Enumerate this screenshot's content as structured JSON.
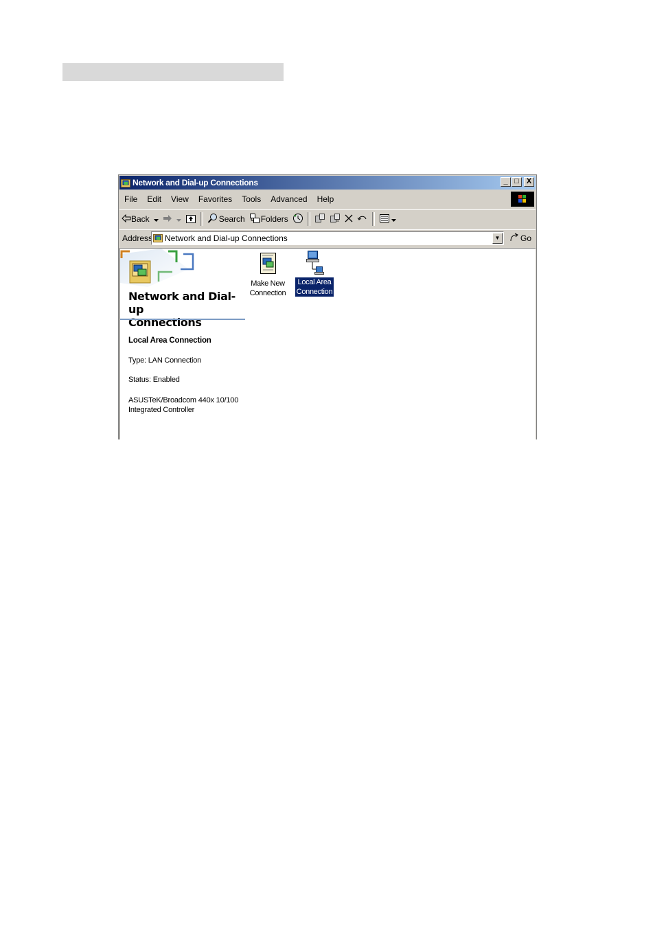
{
  "window": {
    "title": "Network and Dial-up Connections",
    "buttons": {
      "minimize": "_",
      "maximize": "□",
      "close": "X"
    }
  },
  "menu": [
    "File",
    "Edit",
    "View",
    "Favorites",
    "Tools",
    "Advanced",
    "Help"
  ],
  "toolbar": {
    "back": "Back",
    "search": "Search",
    "folders": "Folders"
  },
  "address": {
    "label": "Address",
    "value": "Network and Dial-up Connections",
    "go": "Go"
  },
  "panel": {
    "title_line1": "Network and Dial-up",
    "title_line2": "Connections",
    "selected_name": "Local Area Connection",
    "type": "Type: LAN Connection",
    "status": "Status: Enabled",
    "device_line1": "ASUSTeK/Broadcom 440x 10/100",
    "device_line2": "Integrated Controller"
  },
  "icons": [
    {
      "line1": "Make New",
      "line2": "Connection",
      "selected": false
    },
    {
      "line1": "Local Area",
      "line2": "Connection",
      "selected": true
    }
  ]
}
